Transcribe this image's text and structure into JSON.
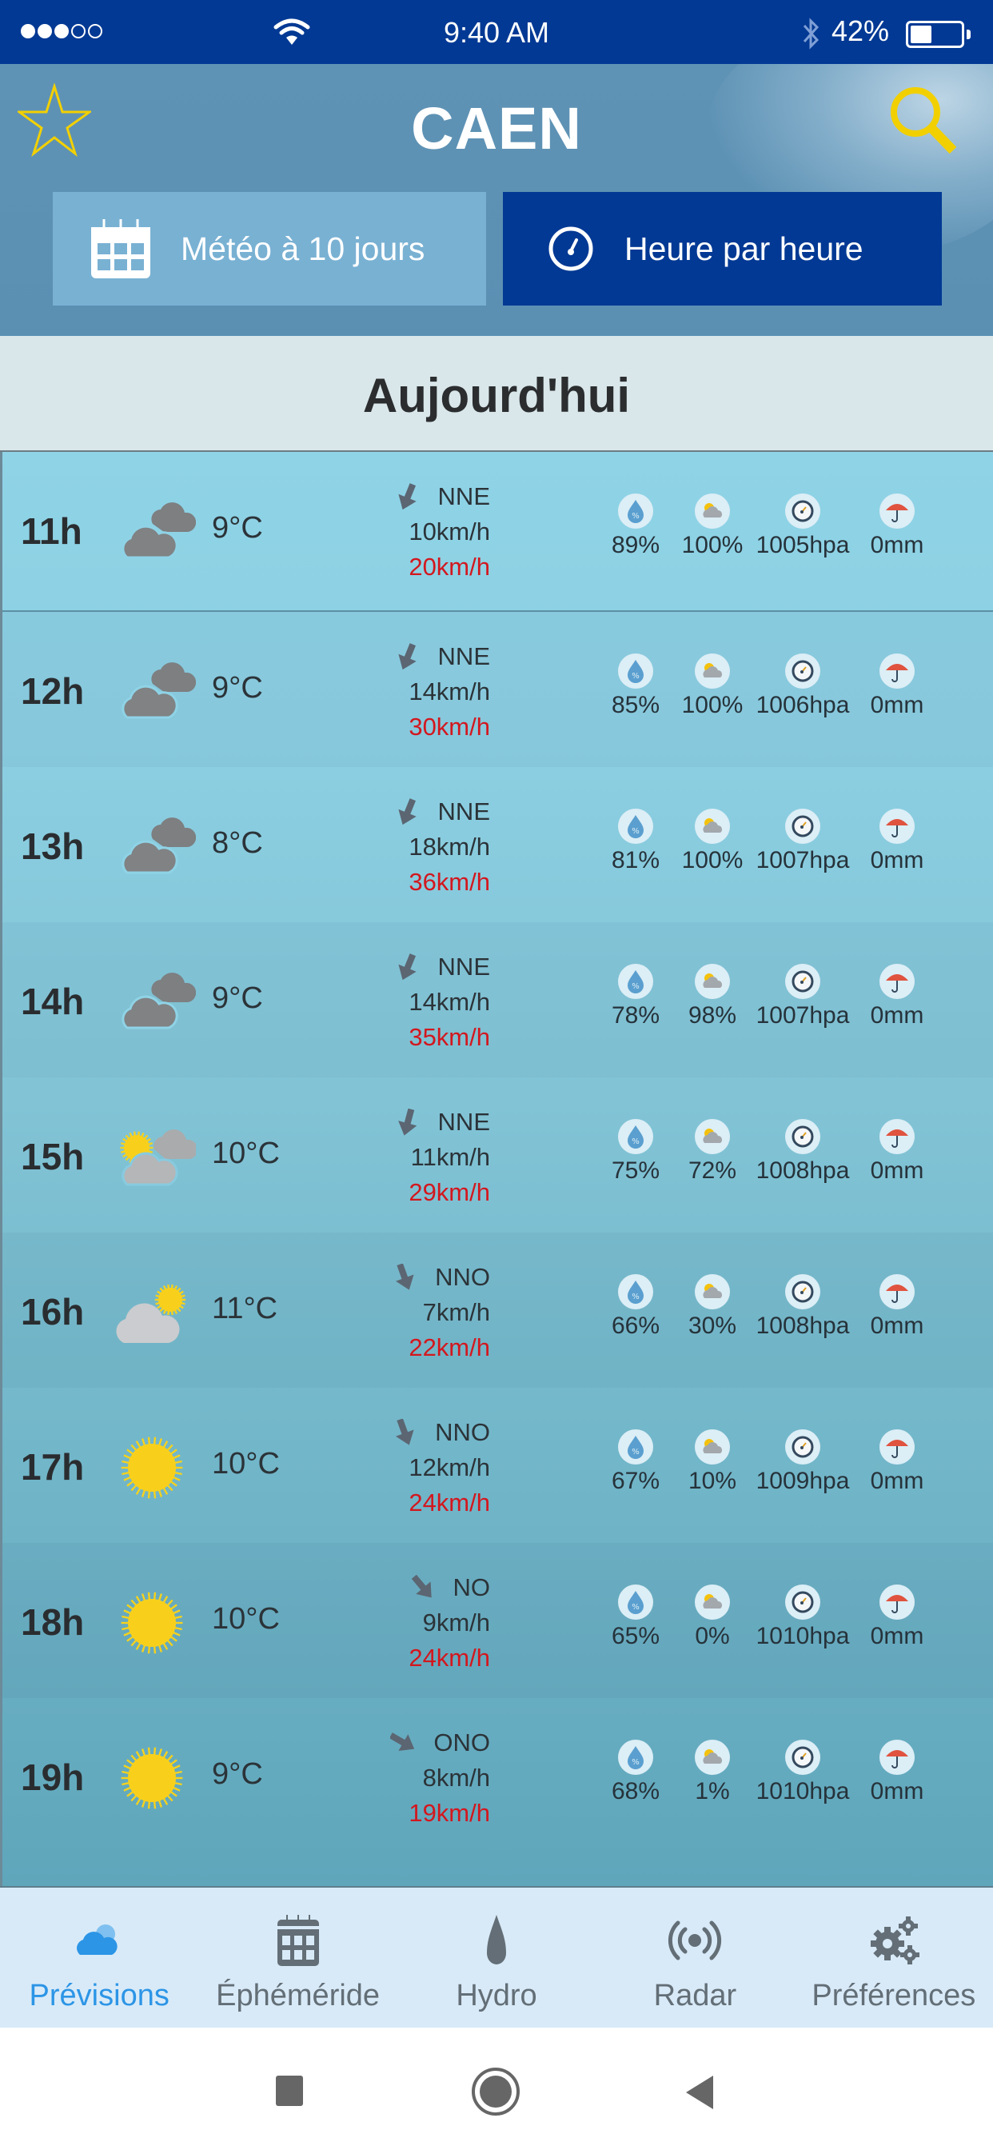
{
  "status_bar": {
    "signal_bars_filled": 3,
    "signal_bars_total": 5,
    "time": "9:40 AM",
    "battery_percent_label": "42%",
    "battery_level": 0.42,
    "icons": [
      "signal-dots-icon",
      "wifi-icon",
      "bluetooth-icon",
      "battery-icon"
    ]
  },
  "header": {
    "city": "CAEN",
    "favorite_icon": "star-outline-icon",
    "search_icon": "search-icon",
    "accent_color": "#f2d000"
  },
  "mode_buttons": {
    "ten_days": {
      "label": "Météo à 10 jours",
      "icon": "calendar-icon",
      "selected": false
    },
    "hourly": {
      "label": "Heure par heure",
      "icon": "clock-icon",
      "selected": true
    }
  },
  "section": {
    "title": "Aujourd'hui"
  },
  "stat_icons": [
    "humidity-icon",
    "cloud-cover-icon",
    "pressure-icon",
    "rain-umbrella-icon"
  ],
  "forecast": [
    {
      "hour": "11h",
      "sky": "cloudy",
      "temp": "9°C",
      "wind_dir": "NNE",
      "wind_angle": 202,
      "wind": "10km/h",
      "gust": "20km/h",
      "humidity": "89%",
      "cloud": "100%",
      "pressure": "1005hpa",
      "rain": "0mm"
    },
    {
      "hour": "12h",
      "sky": "cloudy",
      "temp": "9°C",
      "wind_dir": "NNE",
      "wind_angle": 202,
      "wind": "14km/h",
      "gust": "30km/h",
      "humidity": "85%",
      "cloud": "100%",
      "pressure": "1006hpa",
      "rain": "0mm"
    },
    {
      "hour": "13h",
      "sky": "cloudy",
      "temp": "8°C",
      "wind_dir": "NNE",
      "wind_angle": 202,
      "wind": "18km/h",
      "gust": "36km/h",
      "humidity": "81%",
      "cloud": "100%",
      "pressure": "1007hpa",
      "rain": "0mm"
    },
    {
      "hour": "14h",
      "sky": "cloudy",
      "temp": "9°C",
      "wind_dir": "NNE",
      "wind_angle": 202,
      "wind": "14km/h",
      "gust": "35km/h",
      "humidity": "78%",
      "cloud": "98%",
      "pressure": "1007hpa",
      "rain": "0mm"
    },
    {
      "hour": "15h",
      "sky": "mostly-cloudy",
      "temp": "10°C",
      "wind_dir": "NNE",
      "wind_angle": 195,
      "wind": "11km/h",
      "gust": "29km/h",
      "humidity": "75%",
      "cloud": "72%",
      "pressure": "1008hpa",
      "rain": "0mm"
    },
    {
      "hour": "16h",
      "sky": "partly-cloudy",
      "temp": "11°C",
      "wind_dir": "NNO",
      "wind_angle": 160,
      "wind": "7km/h",
      "gust": "22km/h",
      "humidity": "66%",
      "cloud": "30%",
      "pressure": "1008hpa",
      "rain": "0mm"
    },
    {
      "hour": "17h",
      "sky": "sunny",
      "temp": "10°C",
      "wind_dir": "NNO",
      "wind_angle": 160,
      "wind": "12km/h",
      "gust": "24km/h",
      "humidity": "67%",
      "cloud": "10%",
      "pressure": "1009hpa",
      "rain": "0mm"
    },
    {
      "hour": "18h",
      "sky": "sunny",
      "temp": "10°C",
      "wind_dir": "NO",
      "wind_angle": 140,
      "wind": "9km/h",
      "gust": "24km/h",
      "humidity": "65%",
      "cloud": "0%",
      "pressure": "1010hpa",
      "rain": "0mm"
    },
    {
      "hour": "19h",
      "sky": "sunny",
      "temp": "9°C",
      "wind_dir": "ONO",
      "wind_angle": 120,
      "wind": "8km/h",
      "gust": "19km/h",
      "humidity": "68%",
      "cloud": "1%",
      "pressure": "1010hpa",
      "rain": "0mm"
    }
  ],
  "tabs": [
    {
      "id": "previsions",
      "label": "Prévisions",
      "icon": "cloud-sun-icon",
      "active": true
    },
    {
      "id": "ephemeride",
      "label": "Éphéméride",
      "icon": "calendar-icon",
      "active": false
    },
    {
      "id": "hydro",
      "label": "Hydro",
      "icon": "water-drop-icon",
      "active": false
    },
    {
      "id": "radar",
      "label": "Radar",
      "icon": "radar-icon",
      "active": false
    },
    {
      "id": "preferences",
      "label": "Préférences",
      "icon": "gears-icon",
      "active": false
    }
  ],
  "colors": {
    "status_bar": "#023994",
    "selected_mode": "#023994",
    "unselected_mode": "#79b1d3",
    "gust": "#d3171e",
    "active_tab": "#2c95e6",
    "inactive_tab": "#636e76"
  },
  "android_nav": [
    "recent-apps-button",
    "home-button",
    "back-button"
  ]
}
